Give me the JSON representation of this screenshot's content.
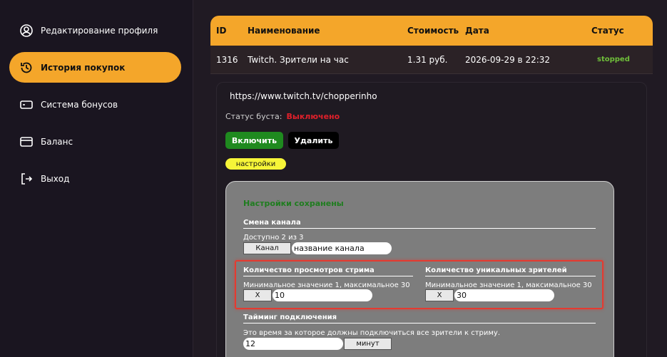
{
  "sidebar": {
    "items": [
      {
        "label": "Редактирование профиля",
        "icon": "user-circle-icon"
      },
      {
        "label": "История покупок",
        "icon": "history-icon"
      },
      {
        "label": "Система бонусов",
        "icon": "bonus-card-icon"
      },
      {
        "label": "Баланс",
        "icon": "wallet-icon"
      },
      {
        "label": "Выход",
        "icon": "logout-icon"
      }
    ],
    "active_index": 1
  },
  "table": {
    "headers": {
      "id": "ID",
      "name": "Наименование",
      "cost": "Стоимость",
      "date": "Дата",
      "status": "Статус"
    },
    "rows": [
      {
        "id": "1316",
        "name": "Twitch. Зрители на час",
        "cost": "1.31 руб.",
        "date": "2026-09-29 в 22:32",
        "status": "stopped"
      }
    ]
  },
  "detail": {
    "url": "https://www.twitch.tv/chopperinho",
    "boost_label": "Статус буста:",
    "boost_value": "Выключено",
    "enable_button": "Включить",
    "delete_button": "Удалить",
    "settings_button": "настройки"
  },
  "settings": {
    "saved_message": "Настройки сохранены",
    "channel": {
      "title": "Смена канала",
      "available": "Доступно 2 из 3",
      "button": "Канал",
      "input_value": "название канала"
    },
    "views": {
      "title": "Количество просмотров стрима",
      "hint": "Минимальное значение 1, максимальное 30",
      "button": "X",
      "value": "10"
    },
    "unique": {
      "title": "Количество уникальных зрителей",
      "hint": "Минимальное значение 1, максимальное 30",
      "button": "X",
      "value": "30"
    },
    "timing": {
      "title": "Тайминг подключения",
      "hint": "Это время за которое должны подключиться все зрители к стриму.",
      "value": "12",
      "unit_button": "минут"
    }
  },
  "colors": {
    "accent": "#f4a62a",
    "status_stopped": "#6fbf3a",
    "boost_off": "#e0202a",
    "enable": "#1f8a1f",
    "settings_tag": "#f6f538",
    "highlight": "#e53a30"
  }
}
